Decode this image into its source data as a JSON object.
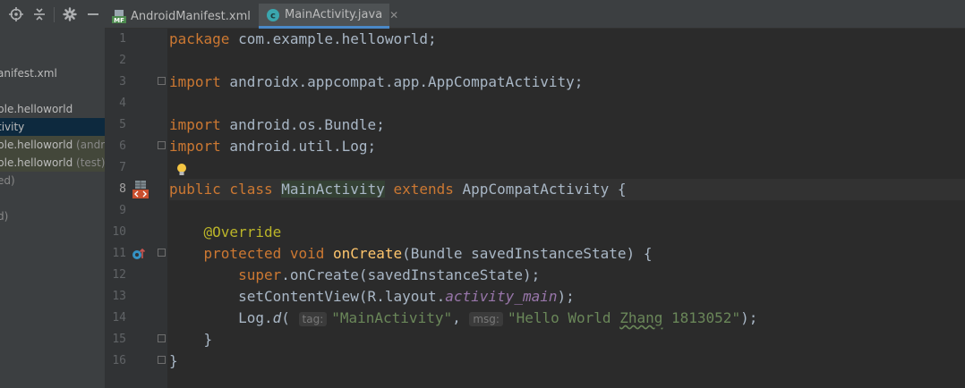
{
  "sidebar": {
    "items": [
      {
        "label": "anifest.xml",
        "detail": "",
        "state": "normal"
      },
      {
        "label": "ple.helloworld",
        "detail": "",
        "state": "normal"
      },
      {
        "label": "tivity",
        "detail": "",
        "state": "selected"
      },
      {
        "label": "ple.helloworld",
        "detail": "(andro",
        "state": "highlight"
      },
      {
        "label": "ple.helloworld",
        "detail": "(test)",
        "state": "highlight"
      },
      {
        "label": "ed)",
        "detail": "",
        "state": "dim"
      },
      {
        "label": "d)",
        "detail": "",
        "state": "dim"
      }
    ]
  },
  "tabs": [
    {
      "label": "AndroidManifest.xml",
      "icon": "manifest-file-icon",
      "active": false
    },
    {
      "label": "MainActivity.java",
      "icon": "java-class-icon",
      "active": true
    }
  ],
  "editor": {
    "current_line": 8,
    "line_numbers": [
      "1",
      "2",
      "3",
      "4",
      "5",
      "6",
      "7",
      "8",
      "9",
      "10",
      "11",
      "12",
      "13",
      "14",
      "15",
      "16"
    ],
    "code": {
      "l1_kw": "package",
      "l1_rest": " com.example.helloworld;",
      "l3_kw": "import",
      "l3_rest": " androidx.appcompat.app.AppCompatActivity;",
      "l5_kw": "import",
      "l5_rest": " android.os.Bundle;",
      "l6_kw": "import",
      "l6_rest": " android.util.Log;",
      "l8_kw1": "public class",
      "l8_name": "MainActivity",
      "l8_kw2": "extends",
      "l8_rest": " AppCompatActivity {",
      "l10_ann": "@Override",
      "l11_kw": "protected void",
      "l11_fn": "onCreate",
      "l11_rest": "(Bundle savedInstanceState) {",
      "l12_kw": "super",
      "l12_rest": ".onCreate(savedInstanceState);",
      "l13_a": "setContentView(R.layout.",
      "l13_field": "activity_main",
      "l13_b": ");",
      "l14_a": "Log.",
      "l14_fn": "d",
      "l14_b": "(",
      "l14_hint1": "tag:",
      "l14_str1": "\"MainActivity\"",
      "l14_c": ", ",
      "l14_hint2": "msg:",
      "l14_str2a": "\"Hello World ",
      "l14_str2b": "Zhang",
      "l14_str2c": " 1813052\"",
      "l14_d": ");",
      "l15": "}",
      "l16": "}"
    },
    "colors": {
      "keyword": "#cc7832",
      "annotation": "#bbb529",
      "method": "#ffc66d",
      "string": "#6a8759",
      "static_field": "#9876aa",
      "default_text": "#a9b7c6",
      "background": "#2b2b2b"
    }
  }
}
